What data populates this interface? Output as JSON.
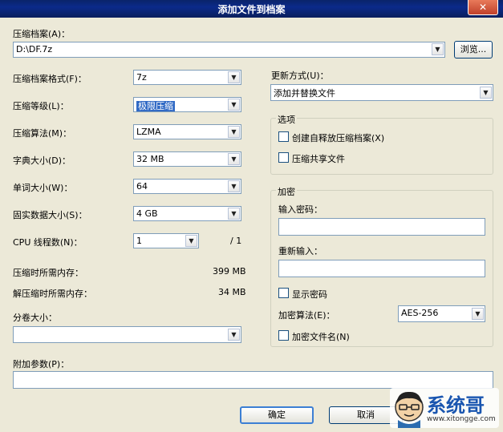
{
  "window": {
    "title": "添加文件到档案",
    "close_glyph": "✕"
  },
  "archive": {
    "label": "压缩档案(A)：",
    "value": "D:\\DF.7z",
    "browse_label": "浏览..."
  },
  "left": {
    "format": {
      "label": "压缩档案格式(F)：",
      "value": "7z"
    },
    "level": {
      "label": "压缩等级(L)：",
      "value": "极限压缩"
    },
    "method": {
      "label": "压缩算法(M)：",
      "value": "LZMA"
    },
    "dict": {
      "label": "字典大小(D)：",
      "value": "32 MB"
    },
    "word": {
      "label": "单词大小(W)：",
      "value": "64"
    },
    "solid": {
      "label": "固实数据大小(S)：",
      "value": "4 GB"
    },
    "threads": {
      "label": "CPU 线程数(N)：",
      "value": "1",
      "total": "/ 1"
    },
    "mem_compress": {
      "label": "压缩时所需内存：",
      "value": "399 MB"
    },
    "mem_decompress": {
      "label": "解压缩时所需内存：",
      "value": "34 MB"
    },
    "volume": {
      "label": "分卷大小：",
      "value": ""
    },
    "params": {
      "label": "附加参数(P)：",
      "value": ""
    }
  },
  "right": {
    "update": {
      "label": "更新方式(U)：",
      "value": "添加并替换文件"
    },
    "options": {
      "legend": "选项",
      "sfx": "创建自释放压缩档案(X)",
      "shared": "压缩共享文件"
    },
    "encryption": {
      "legend": "加密",
      "password_label": "输入密码：",
      "reenter_label": "重新输入：",
      "show_password": "显示密码",
      "method_label": "加密算法(E)：",
      "method_value": "AES-256",
      "encrypt_names": "加密文件名(N)"
    }
  },
  "buttons": {
    "ok": "确定",
    "cancel": "取消"
  },
  "watermark": {
    "text": "系统哥",
    "url": "www.xitongge.com"
  }
}
